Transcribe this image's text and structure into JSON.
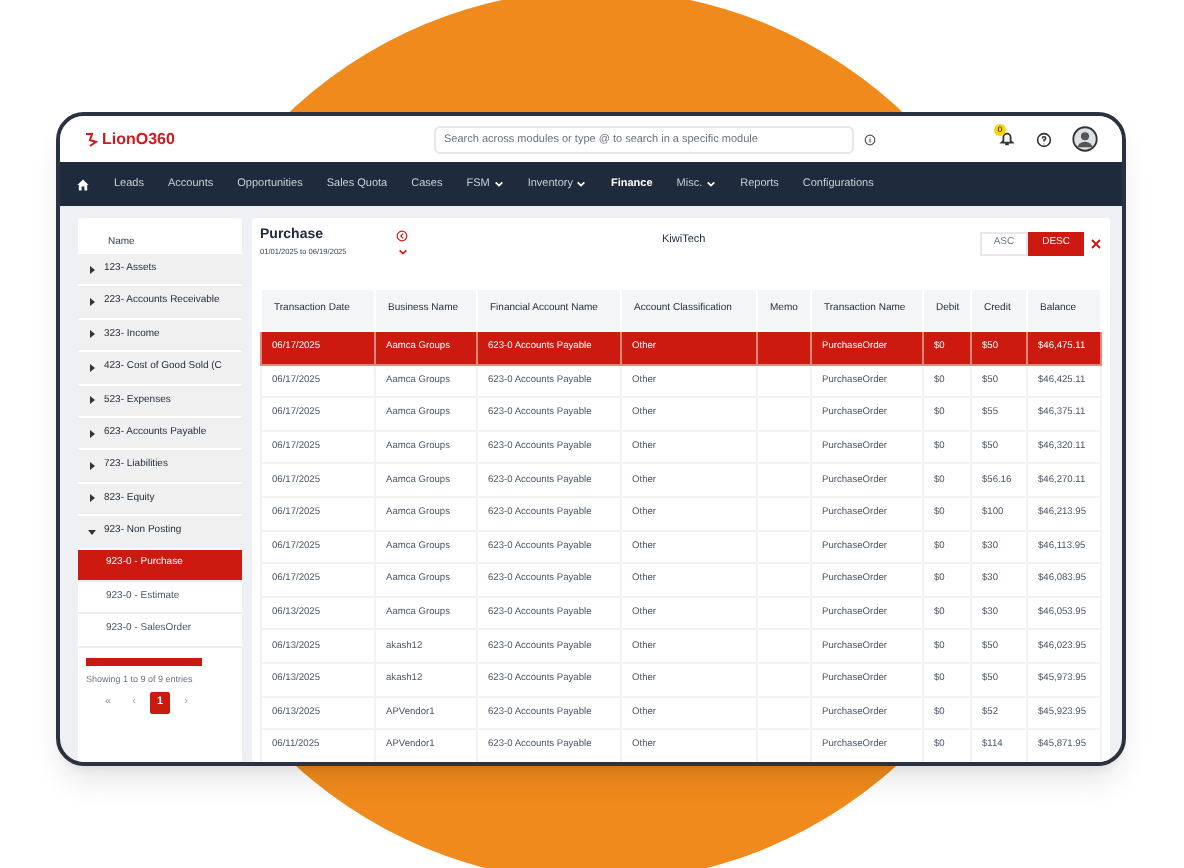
{
  "header": {
    "logo": "LionO360",
    "search": {
      "placeholder": "Search across modules or type @ to search in a specific module"
    },
    "notification_count": "0"
  },
  "nav": [
    {
      "label": "Leads",
      "selected": false,
      "dropdown": false
    },
    {
      "label": "Accounts",
      "selected": false,
      "dropdown": false
    },
    {
      "label": "Opportunities",
      "selected": false,
      "dropdown": false
    },
    {
      "label": "Sales Quota",
      "selected": false,
      "dropdown": false
    },
    {
      "label": "Cases",
      "selected": false,
      "dropdown": false
    },
    {
      "label": "FSM",
      "selected": false,
      "dropdown": true
    },
    {
      "label": "Inventory",
      "selected": false,
      "dropdown": true
    },
    {
      "label": "Finance",
      "selected": true,
      "dropdown": false
    },
    {
      "label": "Misc.",
      "selected": false,
      "dropdown": true
    },
    {
      "label": "Reports",
      "selected": false,
      "dropdown": false
    },
    {
      "label": "Configurations",
      "selected": false,
      "dropdown": false
    }
  ],
  "sidebar": {
    "heading": "Name",
    "items": [
      {
        "label": "123- Assets",
        "expanded": false
      },
      {
        "label": "223- Accounts Receivable",
        "expanded": false
      },
      {
        "label": "323- Income",
        "expanded": false
      },
      {
        "label": "423- Cost of Good Sold (C",
        "expanded": false
      },
      {
        "label": "523- Expenses",
        "expanded": false
      },
      {
        "label": "623- Accounts Payable",
        "expanded": false
      },
      {
        "label": "723- Liabilities",
        "expanded": false
      },
      {
        "label": "823- Equity",
        "expanded": false
      },
      {
        "label": "923- Non Posting",
        "expanded": true,
        "children": [
          {
            "label": "923-0 - Purchase",
            "selected": true
          },
          {
            "label": "923-0 - Estimate",
            "selected": false
          },
          {
            "label": "923-0 - SalesOrder",
            "selected": false
          }
        ]
      }
    ],
    "footer": "Showing 1 to 9 of 9 entries",
    "pagination": [
      {
        "label": "«",
        "selected": false
      },
      {
        "label": "‹",
        "selected": false
      },
      {
        "label": "1",
        "selected": true
      },
      {
        "label": "›",
        "selected": false
      }
    ]
  },
  "report": {
    "title": "Purchase",
    "date_range": "01/01/2025 to 06/19/2025",
    "company": "KiwiTech",
    "sort": [
      {
        "label": "ASC",
        "selected": false
      },
      {
        "label": "DESC",
        "selected": true
      }
    ]
  },
  "table": {
    "columns": [
      "Transaction Date",
      "Business Name",
      "Financial Account Name",
      "Account Classification",
      "Memo",
      "Transaction Name",
      "Debit",
      "Credit",
      "Balance"
    ],
    "rows": [
      {
        "selected": true,
        "cells": [
          "06/17/2025",
          "Aamca Groups",
          "623-0 Accounts Payable",
          "Other",
          "",
          "PurchaseOrder",
          "$0",
          "$50",
          "$46,475.11"
        ]
      },
      {
        "selected": false,
        "cells": [
          "06/17/2025",
          "Aamca Groups",
          "623-0 Accounts Payable",
          "Other",
          "",
          "PurchaseOrder",
          "$0",
          "$50",
          "$46,425.11"
        ]
      },
      {
        "selected": false,
        "cells": [
          "06/17/2025",
          "Aamca Groups",
          "623-0 Accounts Payable",
          "Other",
          "",
          "PurchaseOrder",
          "$0",
          "$55",
          "$46,375.11"
        ]
      },
      {
        "selected": false,
        "cells": [
          "06/17/2025",
          "Aamca Groups",
          "623-0 Accounts Payable",
          "Other",
          "",
          "PurchaseOrder",
          "$0",
          "$50",
          "$46,320.11"
        ]
      },
      {
        "selected": false,
        "cells": [
          "06/17/2025",
          "Aamca Groups",
          "623-0 Accounts Payable",
          "Other",
          "",
          "PurchaseOrder",
          "$0",
          "$56.16",
          "$46,270.11"
        ]
      },
      {
        "selected": false,
        "cells": [
          "06/17/2025",
          "Aamca Groups",
          "623-0 Accounts Payable",
          "Other",
          "",
          "PurchaseOrder",
          "$0",
          "$100",
          "$46,213.95"
        ]
      },
      {
        "selected": false,
        "cells": [
          "06/17/2025",
          "Aamca Groups",
          "623-0 Accounts Payable",
          "Other",
          "",
          "PurchaseOrder",
          "$0",
          "$30",
          "$46,113.95"
        ]
      },
      {
        "selected": false,
        "cells": [
          "06/17/2025",
          "Aamca Groups",
          "623-0 Accounts Payable",
          "Other",
          "",
          "PurchaseOrder",
          "$0",
          "$30",
          "$46,083.95"
        ]
      },
      {
        "selected": false,
        "cells": [
          "06/13/2025",
          "Aamca Groups",
          "623-0 Accounts Payable",
          "Other",
          "",
          "PurchaseOrder",
          "$0",
          "$30",
          "$46,053.95"
        ]
      },
      {
        "selected": false,
        "cells": [
          "06/13/2025",
          "akash12",
          "623-0 Accounts Payable",
          "Other",
          "",
          "PurchaseOrder",
          "$0",
          "$50",
          "$46,023.95"
        ]
      },
      {
        "selected": false,
        "cells": [
          "06/13/2025",
          "akash12",
          "623-0 Accounts Payable",
          "Other",
          "",
          "PurchaseOrder",
          "$0",
          "$50",
          "$45,973.95"
        ]
      },
      {
        "selected": false,
        "cells": [
          "06/13/2025",
          "APVendor1",
          "623-0 Accounts Payable",
          "Other",
          "",
          "PurchaseOrder",
          "$0",
          "$52",
          "$45,923.95"
        ]
      },
      {
        "selected": false,
        "cells": [
          "06/11/2025",
          "APVendor1",
          "623-0 Accounts Payable",
          "Other",
          "",
          "PurchaseOrder",
          "$0",
          "$114",
          "$45,871.95"
        ]
      }
    ]
  }
}
